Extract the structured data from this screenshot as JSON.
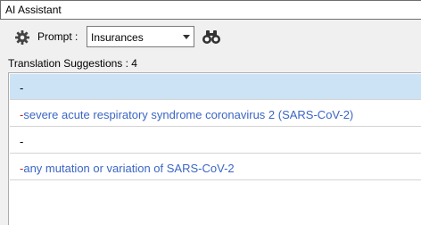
{
  "window": {
    "title": "AI Assistant"
  },
  "toolbar": {
    "prompt_label": "Prompt :",
    "prompt_value": "Insurances"
  },
  "suggestions": {
    "count_label": "Translation Suggestions : 4",
    "items": [
      {
        "prefix": "-",
        "text": ""
      },
      {
        "prefix": "-",
        "text": "severe acute respiratory syndrome coronavirus 2 (SARS-CoV-2)"
      },
      {
        "prefix": "-",
        "text": ""
      },
      {
        "prefix": "-",
        "text": "any mutation or variation of SARS-CoV-2"
      }
    ]
  },
  "icons": {
    "settings": "gear-icon",
    "search": "binoculars-icon",
    "dropdown": "chevron-down-icon"
  },
  "colors": {
    "selection": "#cce3f5",
    "link_text": "#3b66c4",
    "dash_red": "#d62020"
  }
}
